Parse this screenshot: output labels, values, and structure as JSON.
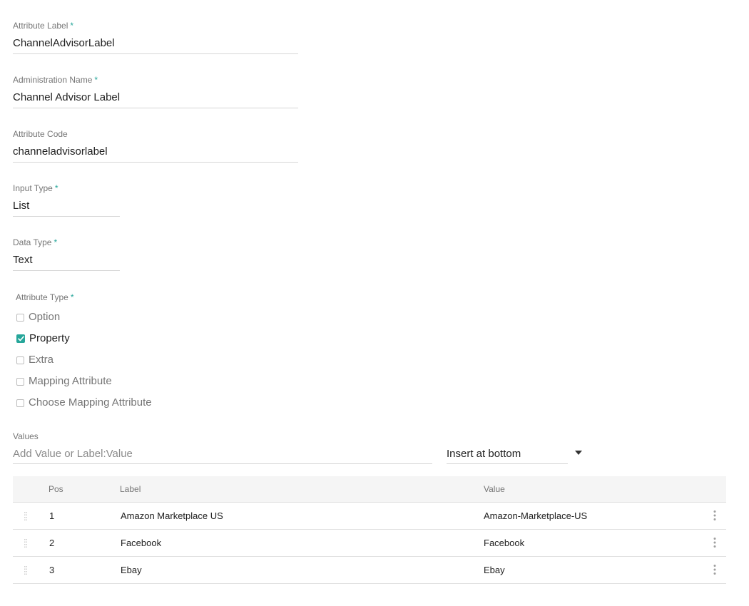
{
  "form": {
    "attribute_label": {
      "label": "Attribute Label",
      "required": "*",
      "value": "ChannelAdvisorLabel"
    },
    "administration_name": {
      "label": "Administration Name",
      "required": "*",
      "value": "Channel Advisor Label"
    },
    "attribute_code": {
      "label": "Attribute Code",
      "value": "channeladvisorlabel"
    },
    "input_type": {
      "label": "Input Type",
      "required": "*",
      "value": "List"
    },
    "data_type": {
      "label": "Data Type",
      "required": "*",
      "value": "Text"
    },
    "attribute_type": {
      "label": "Attribute Type",
      "required": "*",
      "options": [
        {
          "label": "Option",
          "checked": false
        },
        {
          "label": "Property",
          "checked": true
        },
        {
          "label": "Extra",
          "checked": false
        },
        {
          "label": "Mapping Attribute",
          "checked": false
        },
        {
          "label": "Choose Mapping Attribute",
          "checked": false
        }
      ]
    }
  },
  "values": {
    "label": "Values",
    "input_placeholder": "Add Value or Label:Value",
    "insert_position": "Insert at bottom",
    "table": {
      "headers": {
        "pos": "Pos",
        "label": "Label",
        "value": "Value"
      },
      "rows": [
        {
          "pos": "1",
          "label": "Amazon Marketplace US",
          "value": "Amazon-Marketplace-US"
        },
        {
          "pos": "2",
          "label": "Facebook",
          "value": "Facebook"
        },
        {
          "pos": "3",
          "label": "Ebay",
          "value": "Ebay"
        }
      ]
    }
  },
  "colors": {
    "accent": "#26a69a",
    "label_text": "#757575",
    "input_text": "#212121",
    "divider": "#d6d6d6",
    "table_header_bg": "#f5f5f5"
  },
  "icons": {
    "row_drag": "drag-handle-icon",
    "row_menu": "more-vert-icon",
    "select_arrow": "dropdown-arrow-icon",
    "checked": "check-icon"
  }
}
